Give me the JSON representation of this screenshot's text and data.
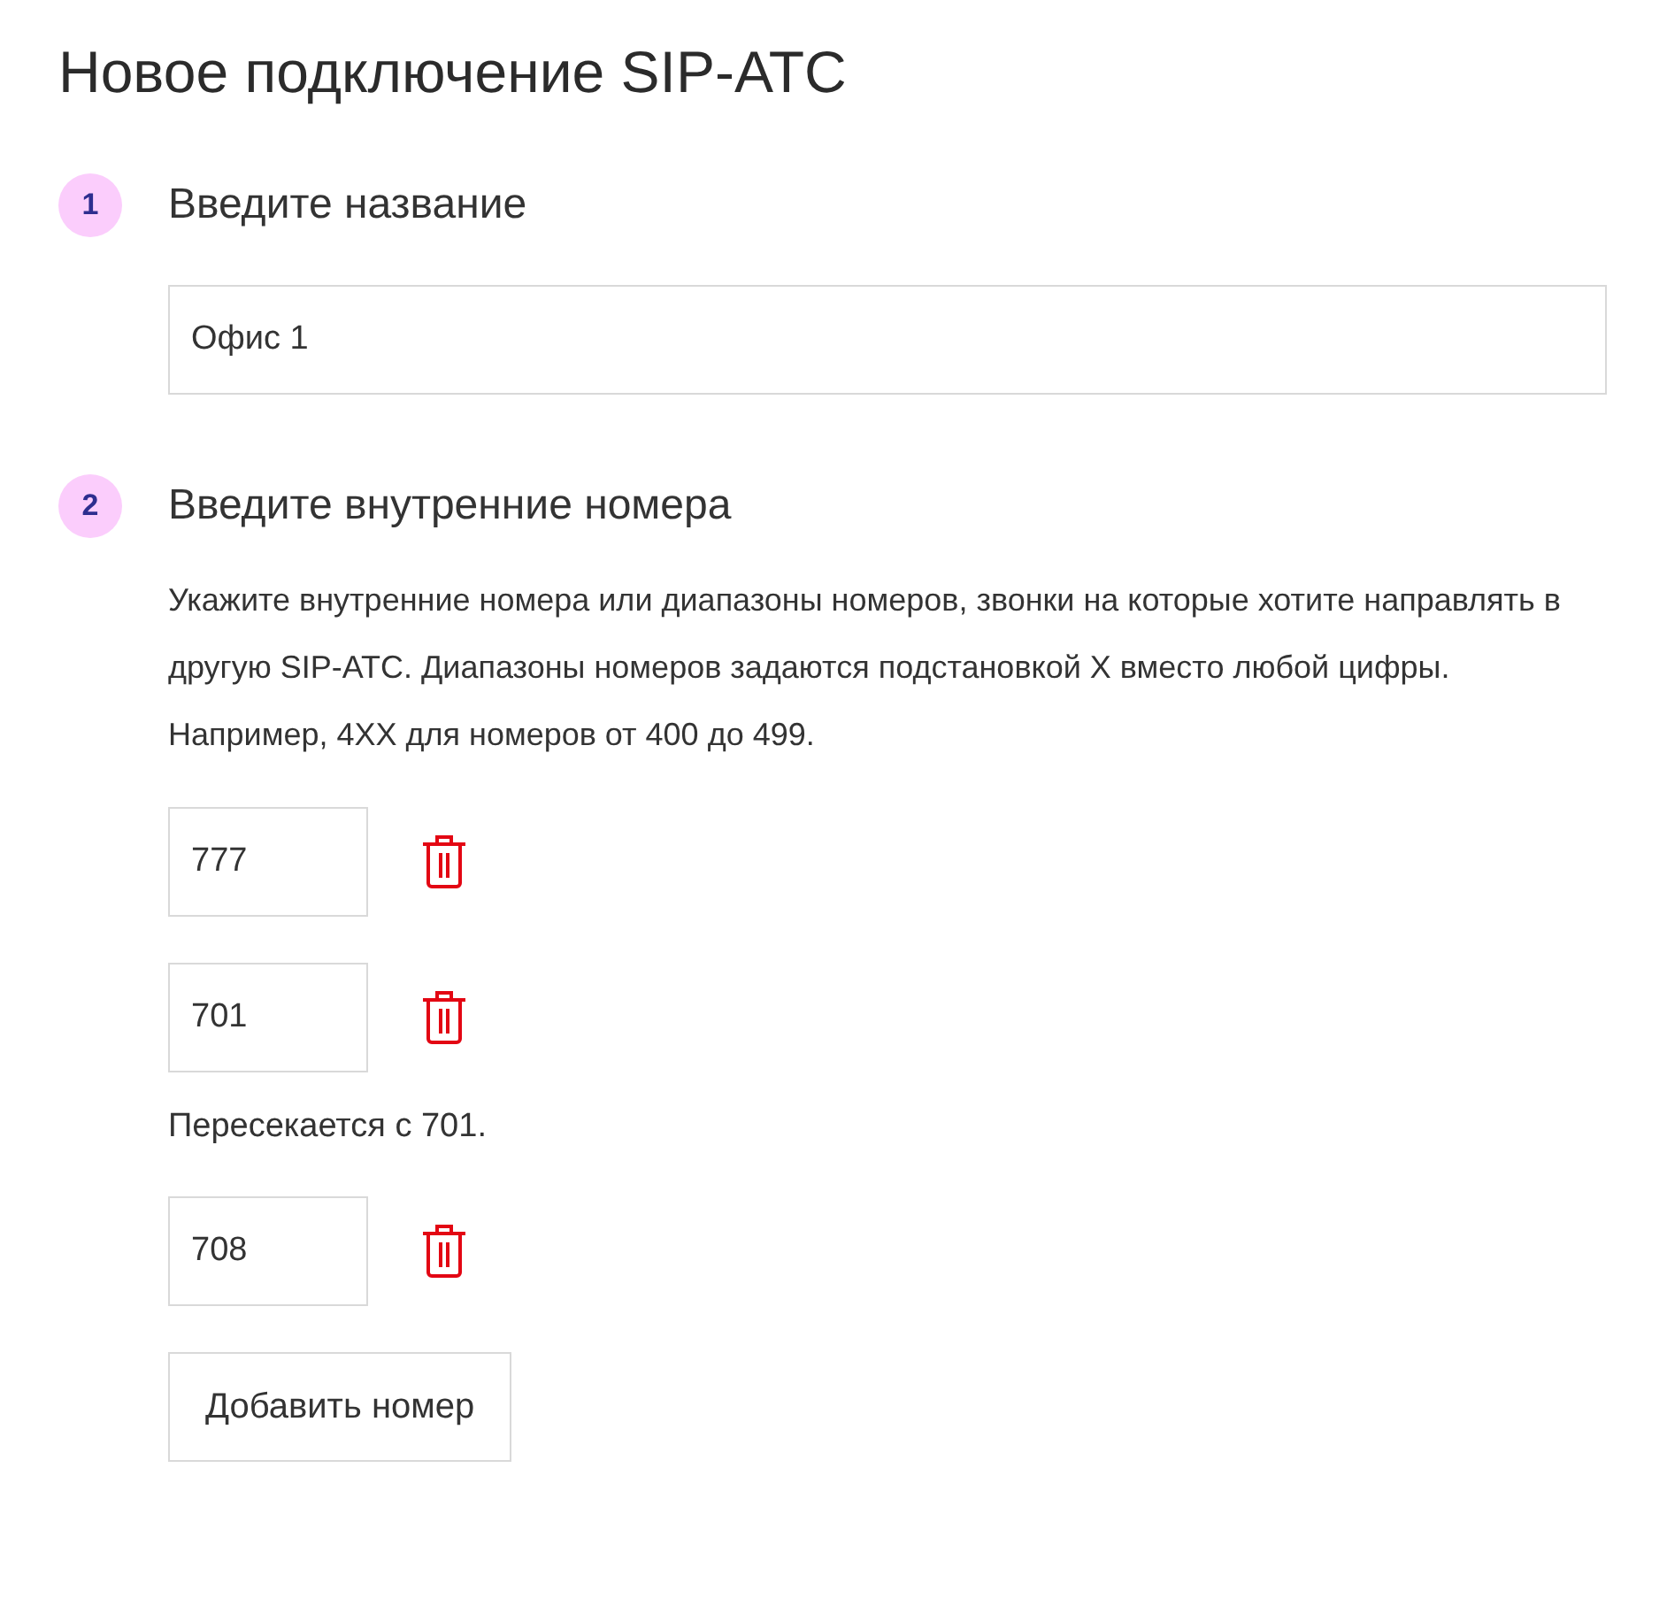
{
  "title": "Новое подключение SIP-АТС",
  "steps": [
    {
      "number": "1",
      "heading": "Введите название",
      "name_field": {
        "value": "Офис 1"
      }
    },
    {
      "number": "2",
      "heading": "Введите внутренние номера",
      "description": "Укажите внутренние номера или диапазоны номеров, звонки на которые хотите направлять в другую SIP-АТС. Диапазоны номеров задаются подстановкой X вместо любой цифры. Например, 4XX для номеров от 400 до 499.",
      "numbers": [
        {
          "value": "777"
        },
        {
          "value": "701",
          "error": "Пересекается с 701."
        },
        {
          "value": "708"
        }
      ],
      "add_button": "Добавить номер"
    }
  ]
}
